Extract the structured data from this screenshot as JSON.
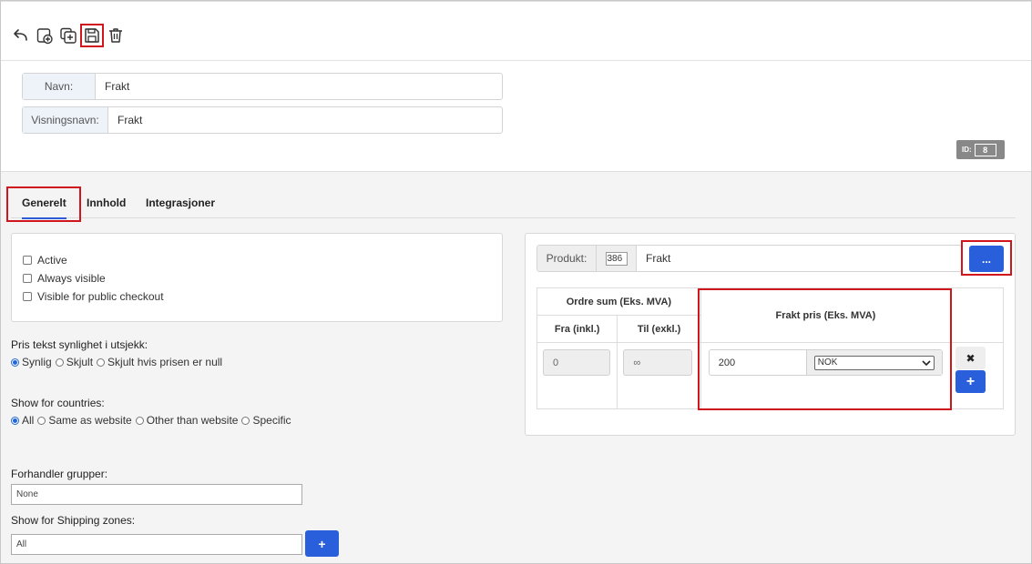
{
  "toolbar": {
    "icons": [
      "back-icon",
      "new-document-icon",
      "duplicate-icon",
      "save-icon",
      "trash-icon"
    ]
  },
  "header": {
    "name_label": "Navn:",
    "name_value": "Frakt",
    "display_label": "Visningsnavn:",
    "display_value": "Frakt",
    "id_label": "ID:",
    "id_value": "8"
  },
  "tabs": [
    {
      "label": "Generelt",
      "active": true
    },
    {
      "label": "Innhold",
      "active": false
    },
    {
      "label": "Integrasjoner",
      "active": false
    }
  ],
  "checkboxes": [
    {
      "label": "Active",
      "checked": false
    },
    {
      "label": "Always visible",
      "checked": false
    },
    {
      "label": "Visible for public checkout",
      "checked": false
    }
  ],
  "price_visibility": {
    "label": "Pris tekst synlighet i utsjekk:",
    "options": [
      "Synlig",
      "Skjult",
      "Skjult hvis prisen er null"
    ],
    "selected": "Synlig"
  },
  "countries": {
    "label": "Show for countries:",
    "options": [
      "All",
      "Same as website",
      "Other than website",
      "Specific"
    ],
    "selected": "All"
  },
  "dealer_groups": {
    "label": "Forhandler grupper:",
    "value": "None"
  },
  "shipping_zones": {
    "label": "Show for Shipping zones:",
    "value": "All",
    "add_symbol": "+"
  },
  "product": {
    "label": "Produkt:",
    "id": "386",
    "value": "Frakt",
    "browse_label": "..."
  },
  "price_table": {
    "order_sum_header": "Ordre sum (Eks. MVA)",
    "from_header": "Fra (inkl.)",
    "to_header": "Til (exkl.)",
    "price_header": "Frakt pris (Eks. MVA)",
    "rows": [
      {
        "from": "0",
        "to": "∞",
        "price": "200",
        "currency": "NOK"
      }
    ],
    "remove_symbol": "✖",
    "add_symbol": "+"
  },
  "colors": {
    "accent": "#2a5fdb",
    "highlight": "#d0161c"
  }
}
